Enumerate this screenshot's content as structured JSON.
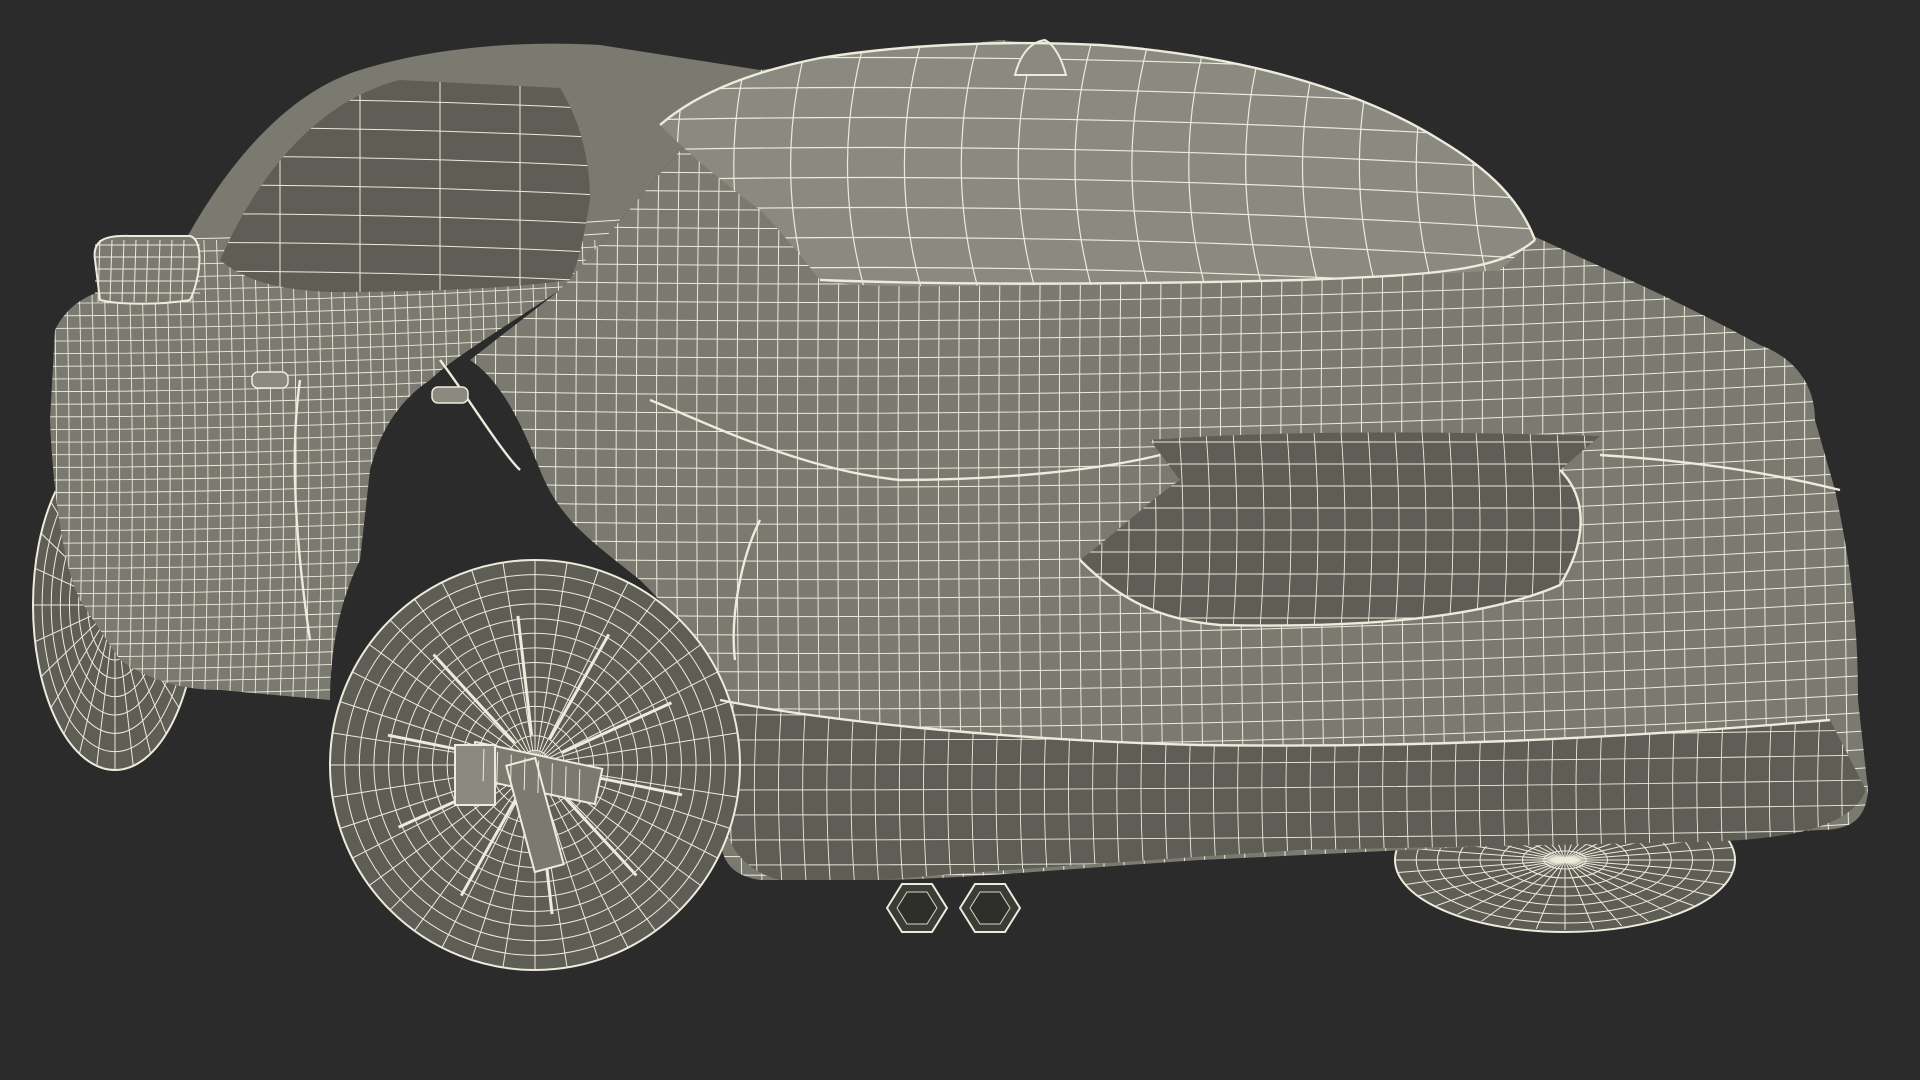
{
  "scene": {
    "subject": "car",
    "view": "rear-three-quarter",
    "render_style": "wireframe-over-clay",
    "accessory": "wheel-alignment-clamp"
  },
  "colors": {
    "background": "#2b2b2b",
    "body_fill": "#7a7a70",
    "body_fill_dark": "#5e5e56",
    "body_fill_light": "#8a8a80",
    "wire": "#ecebdc",
    "wire_dim": "#d8d7c6",
    "shadow": "#3c3c36"
  }
}
